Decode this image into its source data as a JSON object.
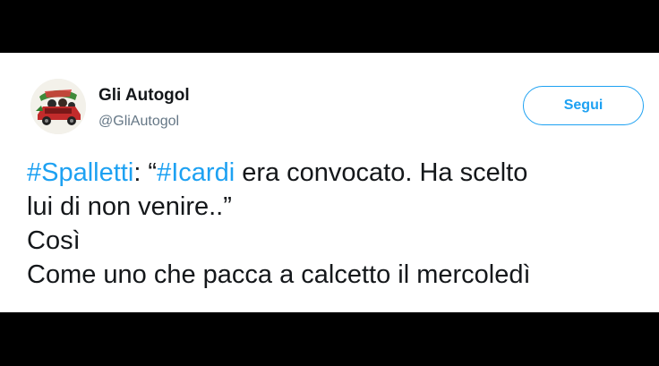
{
  "account": {
    "display_name": "Gli Autogol",
    "handle": "@GliAutogol",
    "avatar_icon": "car-with-people-avatar"
  },
  "follow_button": {
    "label": "Segui"
  },
  "tweet": {
    "line1": {
      "hashtag1": "#Spalletti",
      "text1": ": “",
      "hashtag2": "#Icardi",
      "text2": " era convocato. Ha scelto"
    },
    "line2": "lui di non venire..”",
    "line3": "Così",
    "line4": "Come uno che pacca a calcetto il mercoledì"
  },
  "colors": {
    "background": "#000000",
    "card": "#ffffff",
    "accent": "#1da1f2",
    "text": "#14171a",
    "secondary_text": "#657786"
  }
}
